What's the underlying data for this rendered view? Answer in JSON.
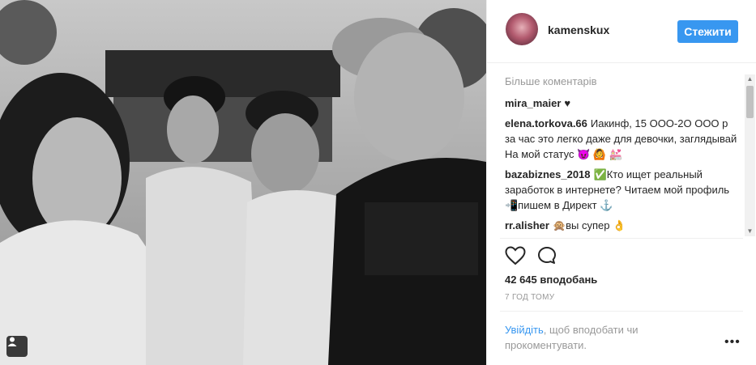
{
  "post": {
    "username": "kamenskux",
    "follow_label": "Стежити",
    "more_comments_label": "Більше коментарів",
    "comments": [
      {
        "author": "mira_maier",
        "text": "♥"
      },
      {
        "author": "elena.torkova.66",
        "text": "Иакинф, 15 ООО-2О ООО р за час это легко даже для девочки, заглядывай На мой статус 😈 🙆 💒"
      },
      {
        "author": "bazabiznes_2018",
        "text": "✅Кто ищет реальный заработок в интернете? Читаем мой профиль📲пишем в Директ ⚓"
      },
      {
        "author": "rr.alisher",
        "text": "🙊вы супер 👌"
      }
    ],
    "likes_label": "42 645 вподобань",
    "time_label": "7 ГОД ТОМУ",
    "login_link": "Увійдіть",
    "login_text": ", щоб вподобати чи прокоментувати.",
    "more_options": "•••"
  },
  "icons": {
    "like": "heart-outline-icon",
    "comment": "speech-bubble-icon",
    "tag": "person-tag-icon"
  },
  "colors": {
    "accent": "#3897f0",
    "muted": "#999999",
    "text": "#262626"
  }
}
